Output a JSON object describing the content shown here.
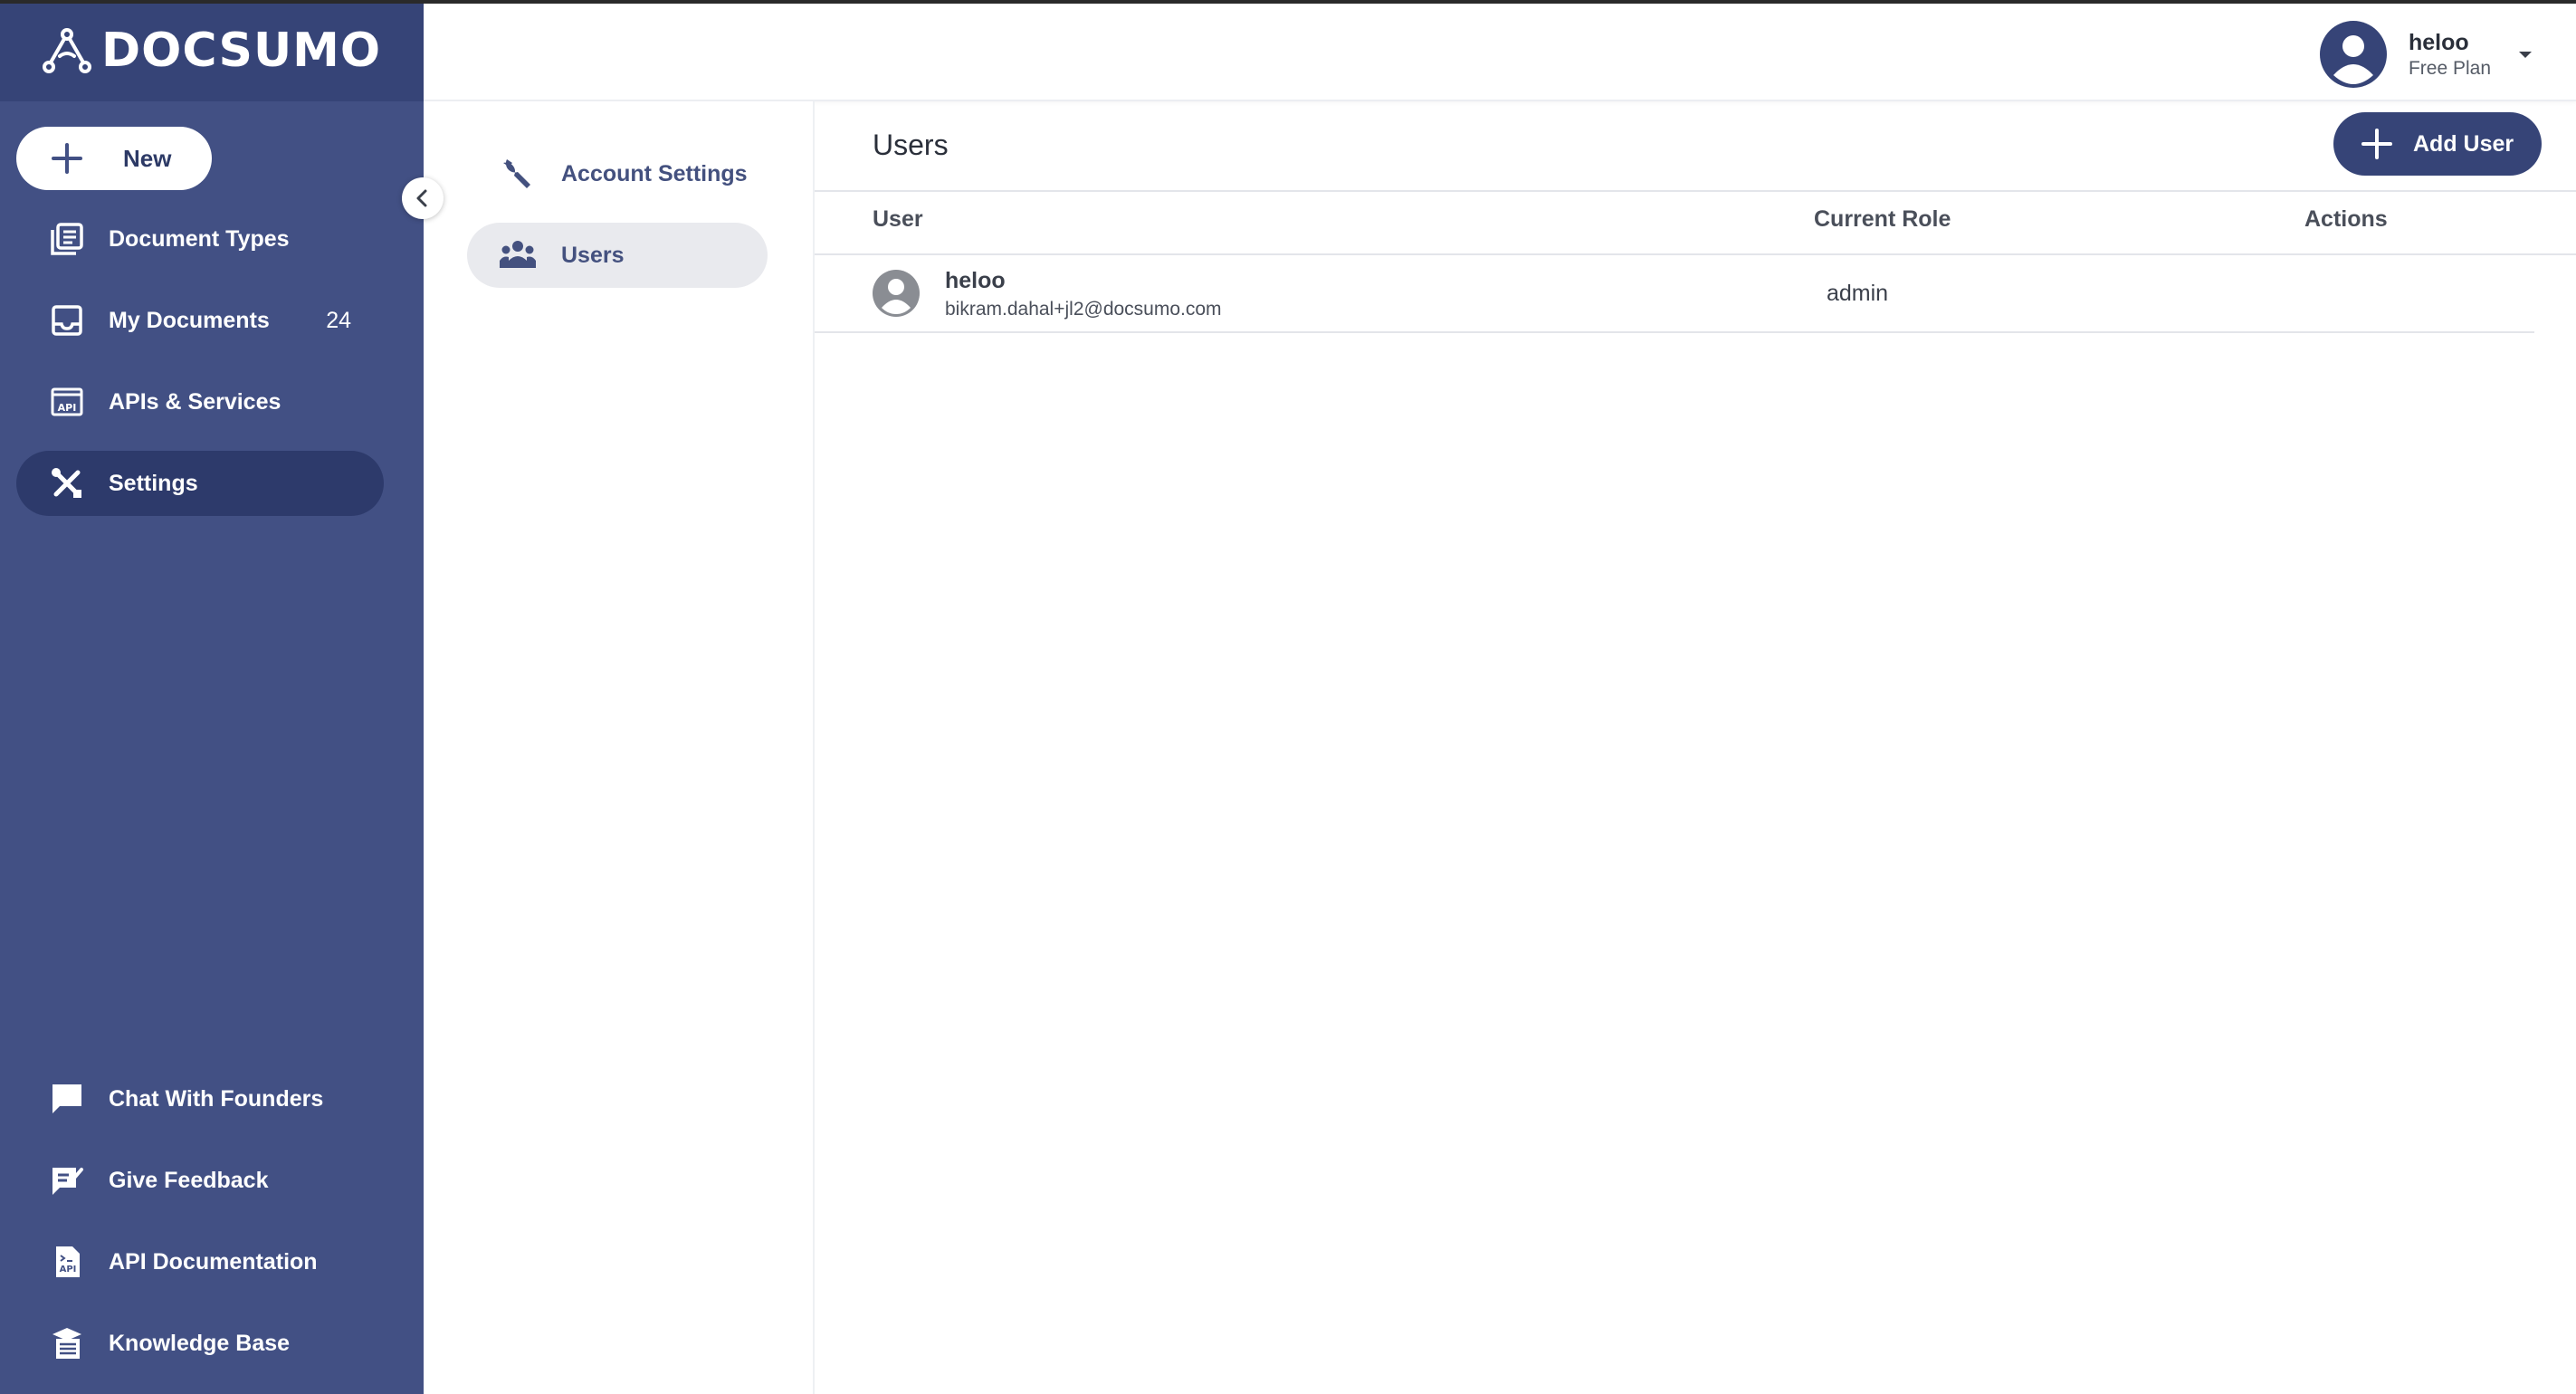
{
  "brand": {
    "name": "DOCSUMO"
  },
  "sidebar": {
    "new_label": "New",
    "items": [
      {
        "label": "Document Types",
        "icon": "document-types-icon"
      },
      {
        "label": "My Documents",
        "icon": "inbox-icon",
        "count": "24"
      },
      {
        "label": "APIs & Services",
        "icon": "api-icon"
      },
      {
        "label": "Settings",
        "icon": "settings-tools-icon",
        "active": true
      }
    ],
    "bottom_items": [
      {
        "label": "Chat With Founders",
        "icon": "chat-icon"
      },
      {
        "label": "Give Feedback",
        "icon": "feedback-icon"
      },
      {
        "label": "API Documentation",
        "icon": "api-doc-icon"
      },
      {
        "label": "Knowledge Base",
        "icon": "knowledge-base-icon"
      }
    ]
  },
  "header": {
    "user_name": "heloo",
    "plan": "Free Plan"
  },
  "settings_nav": [
    {
      "label": "Account Settings",
      "icon": "wrench-icon"
    },
    {
      "label": "Users",
      "icon": "users-group-icon",
      "active": true
    }
  ],
  "main": {
    "title": "Users",
    "add_user_label": "Add User",
    "columns": [
      "User",
      "Current Role",
      "Actions"
    ],
    "rows": [
      {
        "name": "heloo",
        "email": "bikram.dahal+jl2@docsumo.com",
        "role": "admin"
      }
    ]
  },
  "colors": {
    "sidebar_bg": "#425084",
    "brand_bg": "#364477",
    "active_nav": "#2d3a6b",
    "accent": "#364477"
  }
}
